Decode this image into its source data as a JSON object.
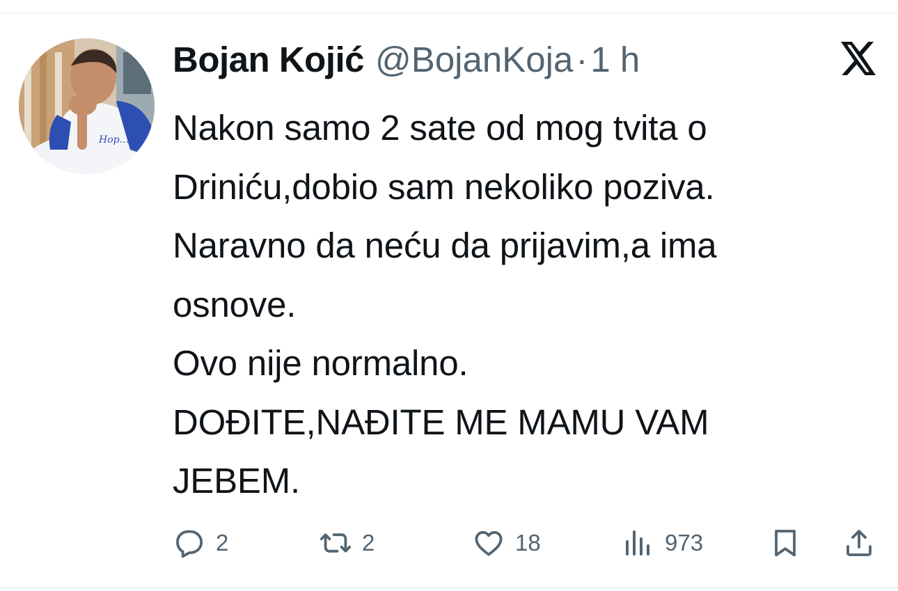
{
  "tweet": {
    "author": {
      "display_name": "Bojan Kojić",
      "handle": "@BojanKoja",
      "separator": "·",
      "time": "1 h"
    },
    "text_lines": [
      "Nakon samo 2 sate od mog tvita o",
      "Driniću,dobio sam nekoliko poziva.",
      "Naravno da neću da prijavim,a ima",
      "osnove.",
      "Ovo nije normalno.",
      "DOĐITE,NAĐITE ME MAMU VAM",
      "JEBEM."
    ],
    "brand_icon": "x-logo-icon",
    "actions": {
      "reply": {
        "icon": "reply-icon",
        "count": "2"
      },
      "repost": {
        "icon": "repost-icon",
        "count": "2"
      },
      "like": {
        "icon": "heart-icon",
        "count": "18"
      },
      "views": {
        "icon": "views-icon",
        "count": "973"
      },
      "bookmark": {
        "icon": "bookmark-icon"
      },
      "share": {
        "icon": "share-icon"
      }
    }
  },
  "colors": {
    "text_primary": "#0f1419",
    "text_secondary": "#536471",
    "divider": "#eff3f4",
    "background": "#ffffff"
  }
}
